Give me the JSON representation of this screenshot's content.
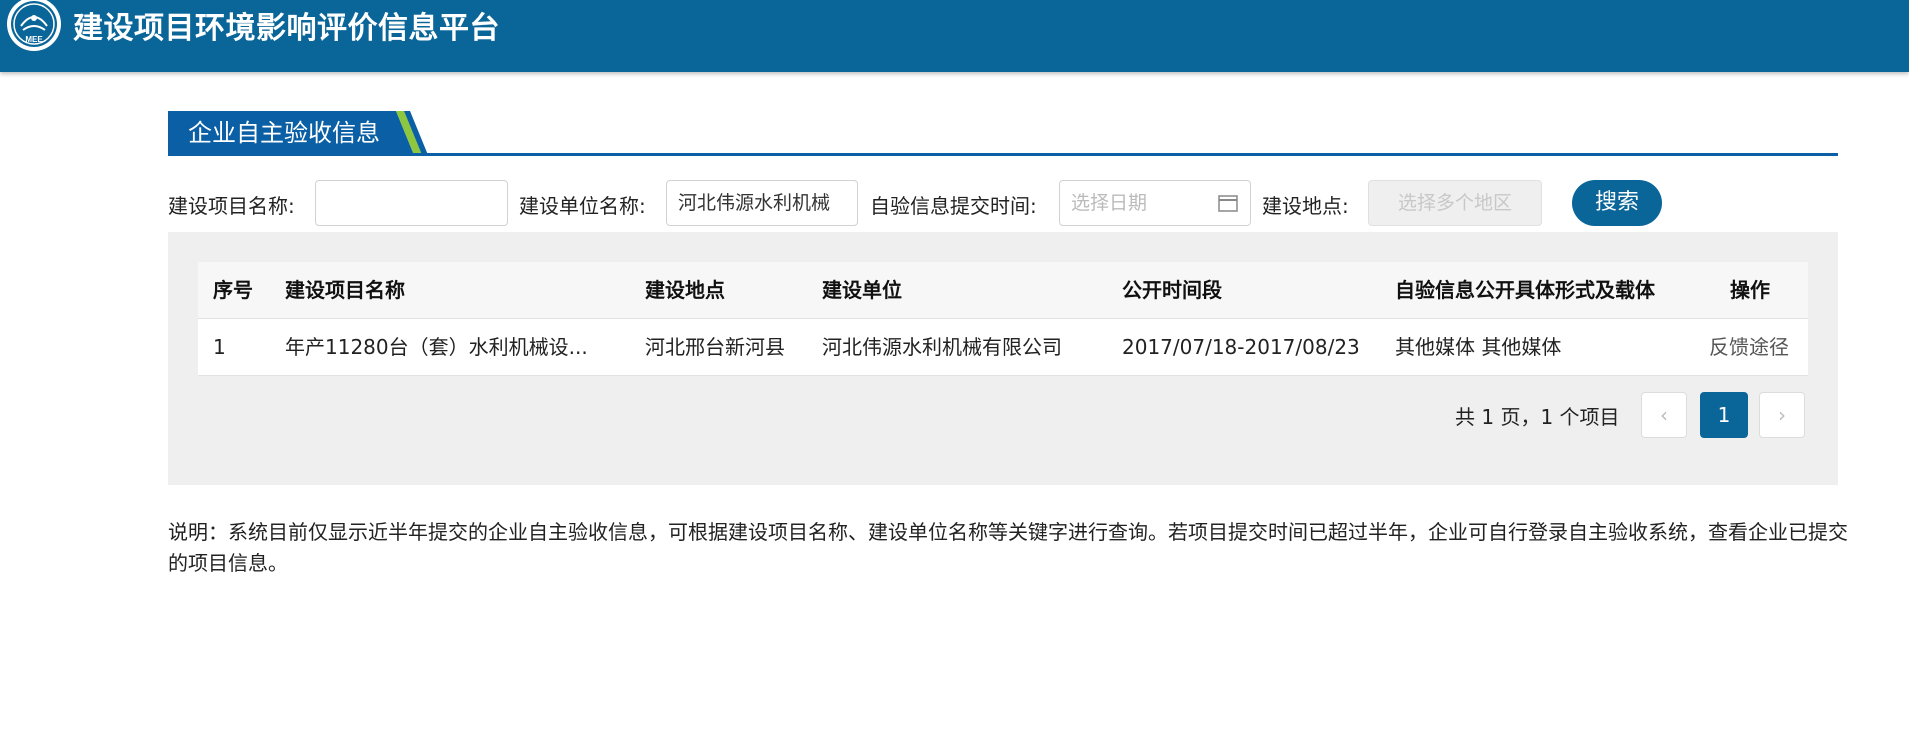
{
  "header": {
    "title": "建设项目环境影响评价信息平台",
    "logo_text": "MEE"
  },
  "section": {
    "title": "企业自主验收信息"
  },
  "filters": {
    "project_name_label": "建设项目名称:",
    "project_name_value": "",
    "company_name_label": "建设单位名称:",
    "company_name_value": "河北伟源水利机械",
    "submit_time_label": "自验信息提交时间:",
    "submit_time_placeholder": "选择日期",
    "location_label": "建设地点:",
    "location_placeholder": "选择多个地区",
    "search_label": "搜索"
  },
  "table": {
    "headers": [
      "序号",
      "建设项目名称",
      "建设地点",
      "建设单位",
      "公开时间段",
      "自验信息公开具体形式及载体",
      "操作"
    ],
    "rows": [
      {
        "index": "1",
        "project": "年产11280台（套）水利机械设...",
        "location": "河北邢台新河县",
        "company": "河北伟源水利机械有限公司",
        "period": "2017/07/18-2017/08/23",
        "media": "其他媒体 其他媒体",
        "action": "反馈途径"
      }
    ]
  },
  "pagination": {
    "summary": "共 1 页，1 个项目",
    "prev": "‹",
    "current_page": "1",
    "next": "›"
  },
  "note": "说明：系统目前仅显示近半年提交的企业自主验收信息，可根据建设项目名称、建设单位名称等关键字进行查询。若项目提交时间已超过半年，企业可自行登录自主验收系统，查看企业已提交的项目信息。",
  "colors": {
    "brand": "#0a6599",
    "tab_blue": "#0a5fa5",
    "tab_accent": "#8dc63f",
    "panel_bg": "#efefef"
  }
}
